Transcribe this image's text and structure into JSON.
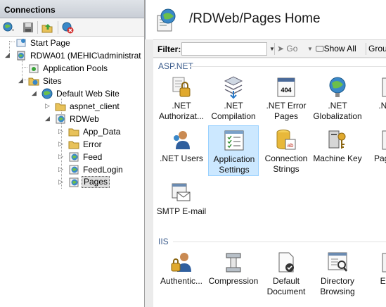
{
  "connections": {
    "title": "Connections",
    "toolbar": [
      "connect-icon",
      "save-icon",
      "up-icon",
      "delete-connection-icon"
    ]
  },
  "tree": {
    "start_page": "Start Page",
    "server": "RDWA01 (MEHIC\\administrat",
    "app_pools": "Application Pools",
    "sites": "Sites",
    "default_site": "Default Web Site",
    "aspnet_client": "aspnet_client",
    "rdweb": "RDWeb",
    "app_data": "App_Data",
    "error": "Error",
    "feed": "Feed",
    "feedlogin": "FeedLogin",
    "pages": "Pages"
  },
  "header": {
    "title": "/RDWeb/Pages Home"
  },
  "filter": {
    "label": "Filter:",
    "value": "",
    "go": "Go",
    "show_all": "Show All",
    "group_by": "Group"
  },
  "sections": {
    "aspnet": "ASP.NET",
    "iis": "IIS"
  },
  "aspnet_features": [
    ".NET Authorizat...",
    ".NET Compilation",
    ".NET Error Pages",
    ".NET Globalization",
    ".NET",
    ".NET Users",
    "Application Settings",
    "Connection Strings",
    "Machine Key",
    "Pag Co",
    "SMTP E-mail"
  ],
  "iis_features": [
    "Authentic...",
    "Compression",
    "Default Document",
    "Directory Browsing",
    "Erro"
  ],
  "colors": {
    "selected_bg": "#cce8ff",
    "section_title": "#3b5c8c"
  }
}
